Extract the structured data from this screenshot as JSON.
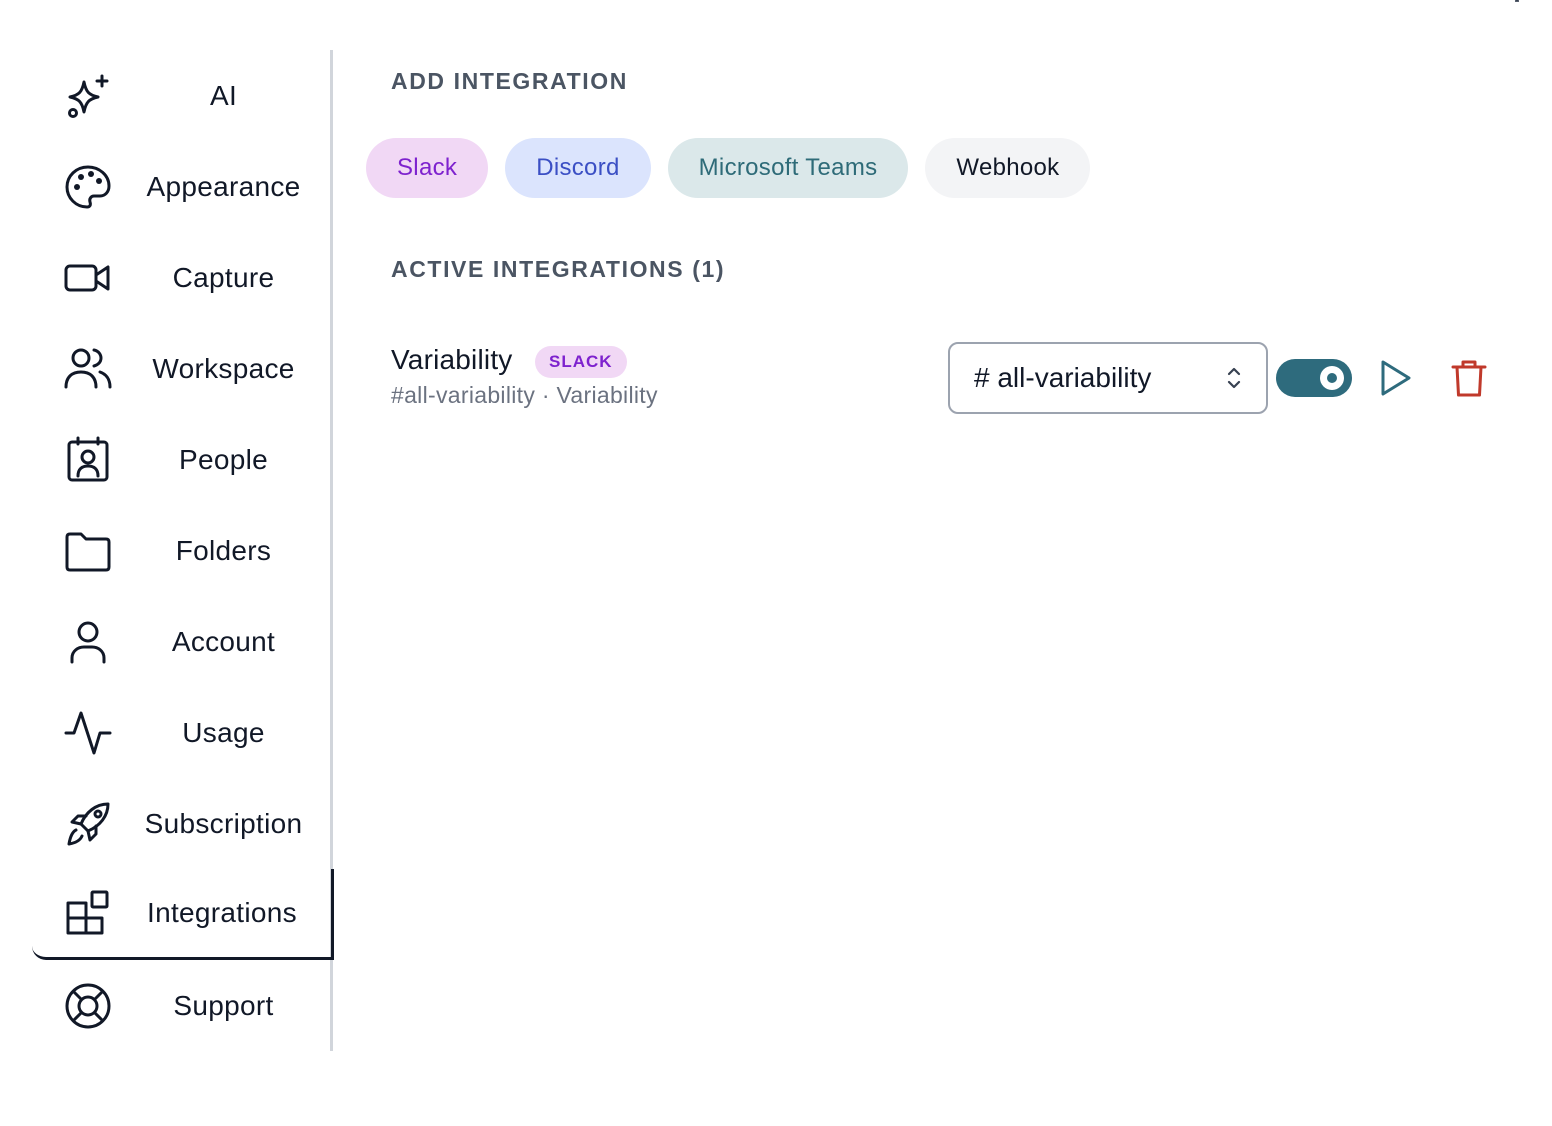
{
  "sidebar": {
    "items": [
      {
        "label": "AI",
        "icon": "sparkles-icon"
      },
      {
        "label": "Appearance",
        "icon": "palette-icon"
      },
      {
        "label": "Capture",
        "icon": "video-camera-icon"
      },
      {
        "label": "Workspace",
        "icon": "users-icon"
      },
      {
        "label": "People",
        "icon": "contact-card-icon"
      },
      {
        "label": "Folders",
        "icon": "folder-icon"
      },
      {
        "label": "Account",
        "icon": "user-icon"
      },
      {
        "label": "Usage",
        "icon": "activity-icon"
      },
      {
        "label": "Subscription",
        "icon": "rocket-icon"
      },
      {
        "label": "Integrations",
        "icon": "grid-plus-icon",
        "active": true
      },
      {
        "label": "Support",
        "icon": "life-buoy-icon"
      }
    ]
  },
  "main": {
    "add_title": "ADD INTEGRATION",
    "add_options": [
      "Slack",
      "Discord",
      "Microsoft Teams",
      "Webhook"
    ],
    "active_title": "ACTIVE INTEGRATIONS (1)",
    "integrations": [
      {
        "name": "Variability",
        "badge": "SLACK",
        "subtitle": "#all-variability · Variability",
        "channel": "# all-variability",
        "enabled": true
      }
    ]
  },
  "colors": {
    "accent": "#2e6b7d",
    "slack_bg": "#f1d8f5",
    "slack_text": "#7e22ce",
    "discord_bg": "#dbe4fd",
    "teams_bg": "#dbe8ea",
    "delete": "#c0392b"
  }
}
